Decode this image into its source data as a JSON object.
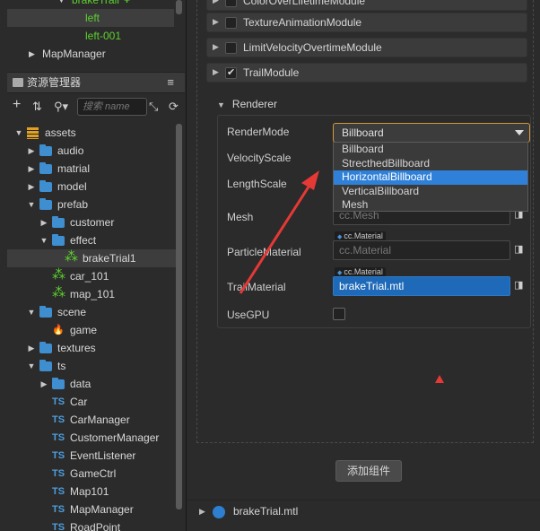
{
  "hierarchy": {
    "top_partial": "brakeTrail",
    "items": [
      {
        "label": "left",
        "selected": true,
        "color": "#5dd12d"
      },
      {
        "label": "left-001",
        "selected": false,
        "color": "#5dd12d"
      },
      {
        "label": "MapManager",
        "selected": false,
        "color": "#d8d8d8"
      }
    ]
  },
  "assets_panel": {
    "title": "资源管理器",
    "menu_icon": "menu-icon",
    "search_placeholder": "搜索 name"
  },
  "tree": [
    {
      "label": "assets",
      "indent": 0,
      "open": true,
      "icon": "db"
    },
    {
      "label": "audio",
      "indent": 1,
      "open": false,
      "icon": "folder"
    },
    {
      "label": "matrial",
      "indent": 1,
      "open": false,
      "icon": "folder"
    },
    {
      "label": "model",
      "indent": 1,
      "open": false,
      "icon": "folder"
    },
    {
      "label": "prefab",
      "indent": 1,
      "open": true,
      "icon": "folder"
    },
    {
      "label": "customer",
      "indent": 2,
      "open": false,
      "icon": "folder"
    },
    {
      "label": "effect",
      "indent": 2,
      "open": true,
      "icon": "folder"
    },
    {
      "label": "brakeTrial1",
      "indent": 3,
      "icon": "prefab",
      "selected": true
    },
    {
      "label": "car_101",
      "indent": 2,
      "icon": "prefab"
    },
    {
      "label": "map_101",
      "indent": 2,
      "icon": "prefab"
    },
    {
      "label": "scene",
      "indent": 1,
      "open": true,
      "icon": "folder"
    },
    {
      "label": "game",
      "indent": 2,
      "icon": "scene"
    },
    {
      "label": "textures",
      "indent": 1,
      "open": false,
      "icon": "folder"
    },
    {
      "label": "ts",
      "indent": 1,
      "open": true,
      "icon": "folder"
    },
    {
      "label": "data",
      "indent": 2,
      "open": false,
      "icon": "folder"
    },
    {
      "label": "Car",
      "indent": 2,
      "icon": "ts"
    },
    {
      "label": "CarManager",
      "indent": 2,
      "icon": "ts"
    },
    {
      "label": "CustomerManager",
      "indent": 2,
      "icon": "ts"
    },
    {
      "label": "EventListener",
      "indent": 2,
      "icon": "ts"
    },
    {
      "label": "GameCtrl",
      "indent": 2,
      "icon": "ts"
    },
    {
      "label": "Map101",
      "indent": 2,
      "icon": "ts"
    },
    {
      "label": "MapManager",
      "indent": 2,
      "icon": "ts"
    },
    {
      "label": "RoadPoint",
      "indent": 2,
      "icon": "ts"
    }
  ],
  "ts_badge": "TS",
  "modules": [
    {
      "label": "ColorOverLifetimeModule",
      "checked": false
    },
    {
      "label": "TextureAnimationModule",
      "checked": false
    },
    {
      "label": "LimitVelocityOvertimeModule",
      "checked": false
    },
    {
      "label": "TrailModule",
      "checked": true
    }
  ],
  "renderer": {
    "title": "Renderer",
    "props": {
      "render_mode": "RenderMode",
      "velocity_scale": "VelocityScale",
      "length_scale": "LengthScale",
      "mesh": "Mesh",
      "particle_material": "ParticleMaterial",
      "trail_material": "TrailMaterial",
      "use_gpu": "UseGPU"
    },
    "render_mode_value": "Billboard",
    "options": [
      "Billboard",
      "StrecthedBillboard",
      "HorizontalBillboard",
      "VerticalBillboard",
      "Mesh"
    ],
    "highlighted_option": 2,
    "mesh_value": "cc.Mesh",
    "particle_material_tag": "cc.Material",
    "particle_material_value": "cc.Material",
    "trail_material_tag": "cc.Material",
    "trail_material_value": "brakeTrial.mtl",
    "use_gpu": false
  },
  "add_component_label": "添加组件",
  "bottom_asset": "brakeTrial.mtl",
  "colors": {
    "accent_select": "#d59a3a",
    "highlight": "#2f80d8",
    "annotation": "#e53935"
  }
}
